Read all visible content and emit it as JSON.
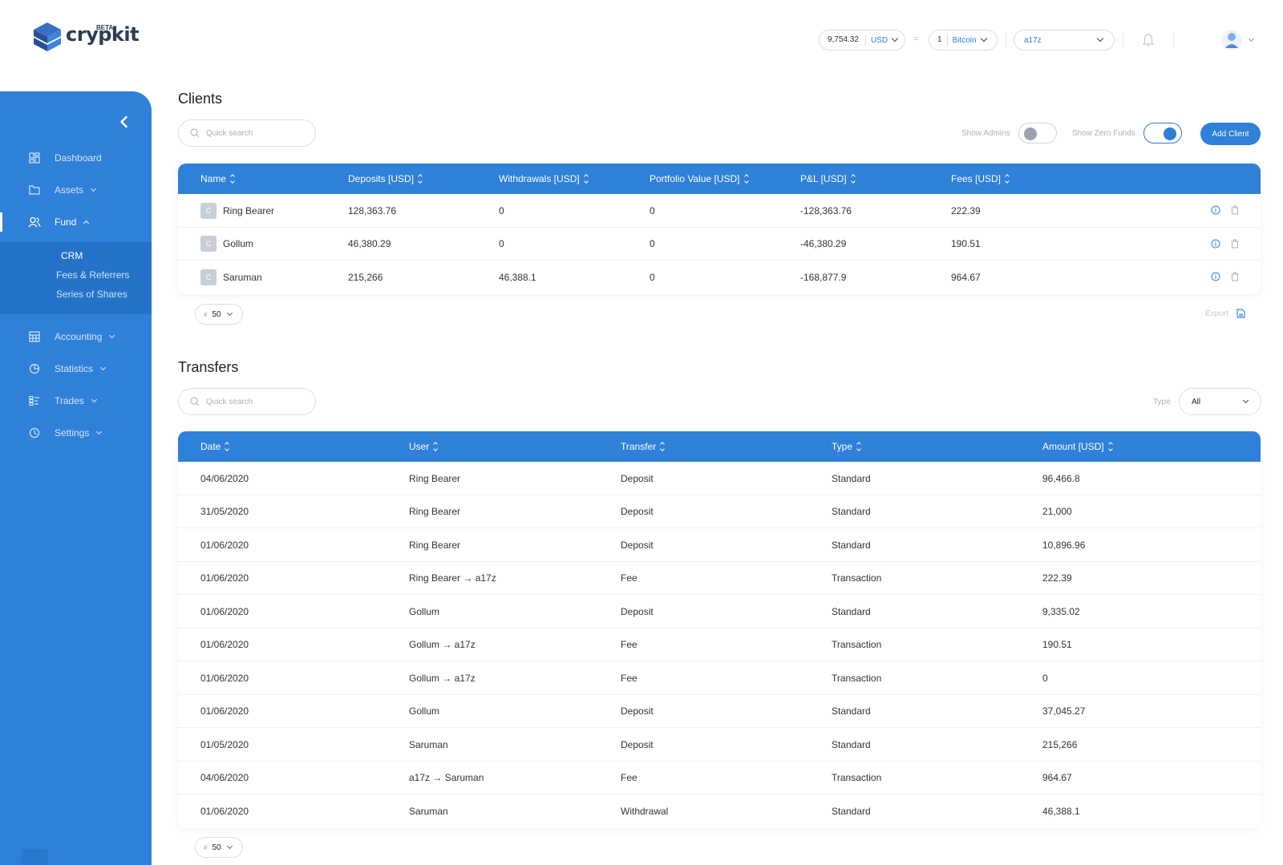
{
  "brand": {
    "name": "crypkit",
    "badge": "BETA"
  },
  "topbar": {
    "balance_value": "9,754.32",
    "balance_currency": "USD",
    "eq_sign": "=",
    "coin_amount": "1",
    "coin_name": "Bitcoin",
    "account": "a17z"
  },
  "sidebar": {
    "items": [
      {
        "label": "Dashboard",
        "icon": "dashboard-icon"
      },
      {
        "label": "Assets",
        "icon": "folder-icon"
      },
      {
        "label": "Fund",
        "icon": "users-icon"
      },
      {
        "label": "Accounting",
        "icon": "calculator-icon"
      },
      {
        "label": "Statistics",
        "icon": "pie-chart-icon"
      },
      {
        "label": "Trades",
        "icon": "list-icon"
      },
      {
        "label": "Settings",
        "icon": "settings-icon"
      }
    ],
    "fund_sub": [
      "CRM",
      "Fees & Referrers",
      "Series of Shares"
    ]
  },
  "clients": {
    "title": "Clients",
    "search_placeholder": "Quick search",
    "show_admins_label": "Show Admins",
    "show_admins": false,
    "show_zero_funds_label": "Show Zero Funds",
    "show_zero_funds": true,
    "add_label": "Add Client",
    "columns": [
      "Name",
      "Deposits [USD]",
      "Withdrawals [USD]",
      "Portfolio Value [USD]",
      "P&L [USD]",
      "Fees [USD]"
    ],
    "rows": [
      {
        "initial": "C",
        "name": "Ring Bearer",
        "deposits": "128,363.76",
        "withdrawals": "0",
        "portfolio": "0",
        "pnl": "-128,363.76",
        "fees": "222.39"
      },
      {
        "initial": "C",
        "name": "Gollum",
        "deposits": "46,380.29",
        "withdrawals": "0",
        "portfolio": "0",
        "pnl": "-46,380.29",
        "fees": "190.51"
      },
      {
        "initial": "C",
        "name": "Saruman",
        "deposits": "215,266",
        "withdrawals": "46,388.1",
        "portfolio": "0",
        "pnl": "-168,877.9",
        "fees": "964.67"
      }
    ],
    "per_page_symbol": "#",
    "per_page": "50",
    "export_label": "Export"
  },
  "transfers": {
    "title": "Transfers",
    "search_placeholder": "Quick search",
    "type_label": "Type",
    "type_value": "All",
    "columns": [
      "Date",
      "User",
      "Transfer",
      "Type",
      "Amount [USD]"
    ],
    "rows": [
      {
        "date": "04/06/2020",
        "user": "Ring Bearer",
        "transfer": "Deposit",
        "type": "Standard",
        "amount": "96,466.8"
      },
      {
        "date": "31/05/2020",
        "user": "Ring Bearer",
        "transfer": "Deposit",
        "type": "Standard",
        "amount": "21,000"
      },
      {
        "date": "01/06/2020",
        "user": "Ring Bearer",
        "transfer": "Deposit",
        "type": "Standard",
        "amount": "10,896.96"
      },
      {
        "date": "01/06/2020",
        "user": "Ring Bearer → a17z",
        "transfer": "Fee",
        "type": "Transaction",
        "amount": "222.39"
      },
      {
        "date": "01/06/2020",
        "user": "Gollum",
        "transfer": "Deposit",
        "type": "Standard",
        "amount": "9,335.02"
      },
      {
        "date": "01/06/2020",
        "user": "Gollum → a17z",
        "transfer": "Fee",
        "type": "Transaction",
        "amount": "190.51"
      },
      {
        "date": "01/06/2020",
        "user": "Gollum → a17z",
        "transfer": "Fee",
        "type": "Transaction",
        "amount": "0"
      },
      {
        "date": "01/06/2020",
        "user": "Gollum",
        "transfer": "Deposit",
        "type": "Standard",
        "amount": "37,045.27"
      },
      {
        "date": "01/05/2020",
        "user": "Saruman",
        "transfer": "Deposit",
        "type": "Standard",
        "amount": "215,266"
      },
      {
        "date": "04/06/2020",
        "user": "a17z → Saruman",
        "transfer": "Fee",
        "type": "Transaction",
        "amount": "964.67"
      },
      {
        "date": "01/06/2020",
        "user": "Saruman",
        "transfer": "Withdrawal",
        "type": "Standard",
        "amount": "46,388.1"
      }
    ],
    "per_page_symbol": "#",
    "per_page": "50"
  },
  "colors": {
    "primary": "#2f80d8",
    "sidebar_sub": "#2473c9",
    "logo": "#2b3d55"
  }
}
